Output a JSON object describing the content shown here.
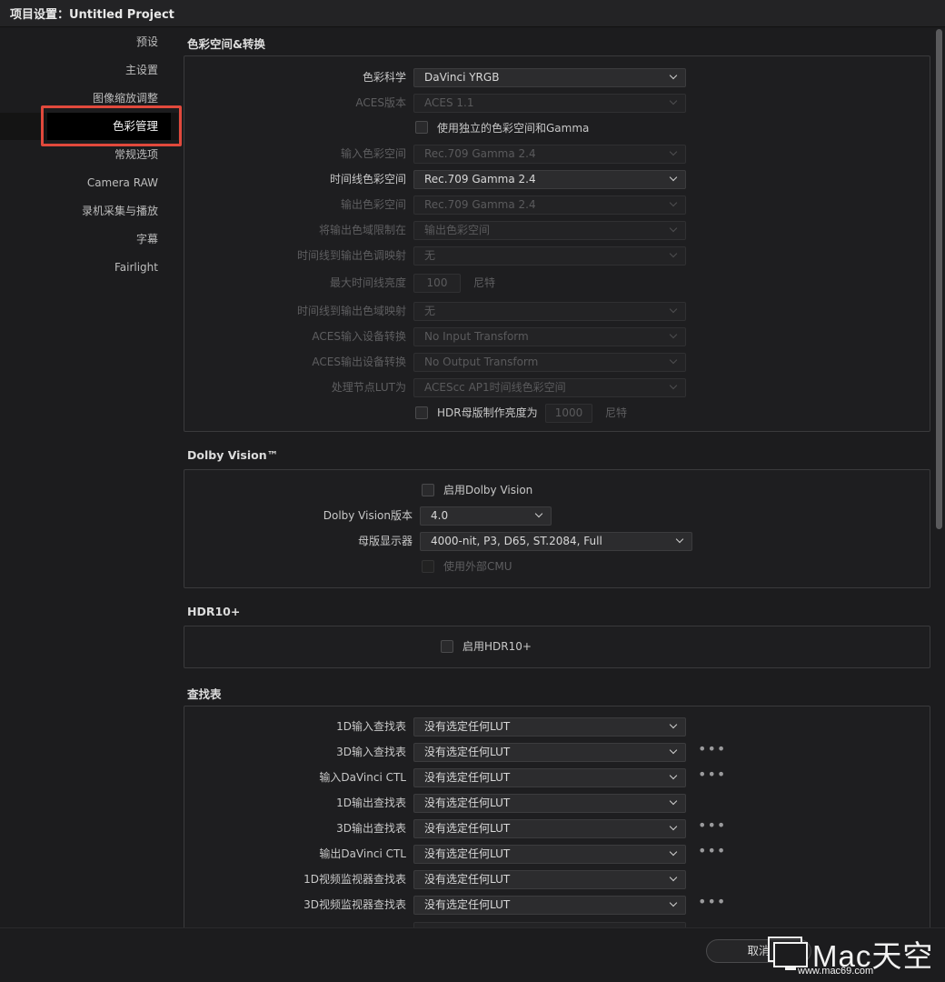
{
  "window": {
    "title": "项目设置：Untitled Project"
  },
  "sidebar": {
    "items": [
      {
        "label": "预设"
      },
      {
        "label": "主设置"
      },
      {
        "label": "图像缩放调整"
      },
      {
        "label": "色彩管理",
        "active": true
      },
      {
        "label": "常规选项"
      },
      {
        "label": "Camera RAW"
      },
      {
        "label": "录机采集与播放"
      },
      {
        "label": "字幕"
      },
      {
        "label": "Fairlight"
      }
    ]
  },
  "color_space": {
    "title": "色彩空间&转换",
    "color_science": {
      "label": "色彩科学",
      "value": "DaVinci YRGB"
    },
    "aces_version": {
      "label": "ACES版本",
      "value": "ACES 1.1"
    },
    "separate_gamma": {
      "label": "使用独立的色彩空间和Gamma",
      "checked": false
    },
    "input_space": {
      "label": "输入色彩空间",
      "value": "Rec.709 Gamma 2.4"
    },
    "timeline_space": {
      "label": "时间线色彩空间",
      "value": "Rec.709 Gamma 2.4"
    },
    "output_space": {
      "label": "输出色彩空间",
      "value": "Rec.709 Gamma 2.4"
    },
    "limit_gamut": {
      "label": "将输出色域限制在",
      "value": "输出色彩空间"
    },
    "tone_mapping": {
      "label": "时间线到输出色调映射",
      "value": "无"
    },
    "max_luminance": {
      "label": "最大时间线亮度",
      "value": "100",
      "unit": "尼特"
    },
    "gamut_mapping": {
      "label": "时间线到输出色域映射",
      "value": "无"
    },
    "aces_input": {
      "label": "ACES输入设备转换",
      "value": "No Input Transform"
    },
    "aces_output": {
      "label": "ACES输出设备转换",
      "value": "No Output Transform"
    },
    "process_lut": {
      "label": "处理节点LUT为",
      "value": "ACEScc AP1时间线色彩空间"
    },
    "hdr_mastering": {
      "label": "HDR母版制作亮度为",
      "value": "1000",
      "unit": "尼特",
      "checked": false
    }
  },
  "dolby": {
    "title": "Dolby Vision™",
    "enable": {
      "label": "启用Dolby Vision",
      "checked": false
    },
    "version": {
      "label": "Dolby Vision版本",
      "value": "4.0"
    },
    "display": {
      "label": "母版显示器",
      "value": "4000-nit, P3, D65, ST.2084, Full"
    },
    "external_cmu": {
      "label": "使用外部CMU",
      "checked": false
    }
  },
  "hdr10": {
    "title": "HDR10+",
    "enable": {
      "label": "启用HDR10+",
      "checked": false
    }
  },
  "lut": {
    "title": "查找表",
    "rows": [
      {
        "label": "1D输入查找表",
        "value": "没有选定任何LUT",
        "more": false
      },
      {
        "label": "3D输入查找表",
        "value": "没有选定任何LUT",
        "more": true
      },
      {
        "label": "输入DaVinci CTL",
        "value": "没有选定任何LUT",
        "more": true
      },
      {
        "label": "1D输出查找表",
        "value": "没有选定任何LUT",
        "more": false
      },
      {
        "label": "3D输出查找表",
        "value": "没有选定任何LUT",
        "more": true
      },
      {
        "label": "输出DaVinci CTL",
        "value": "没有选定任何LUT",
        "more": true
      },
      {
        "label": "1D视频监视器查找表",
        "value": "没有选定任何LUT",
        "more": false
      },
      {
        "label": "3D视频监视器查找表",
        "value": "没有选定任何LUT",
        "more": true
      }
    ],
    "more_glyph": "•••"
  },
  "footer": {
    "cancel_label": "取消"
  },
  "watermark": {
    "brand": "Mac天空",
    "url": "www.mac69.com"
  }
}
